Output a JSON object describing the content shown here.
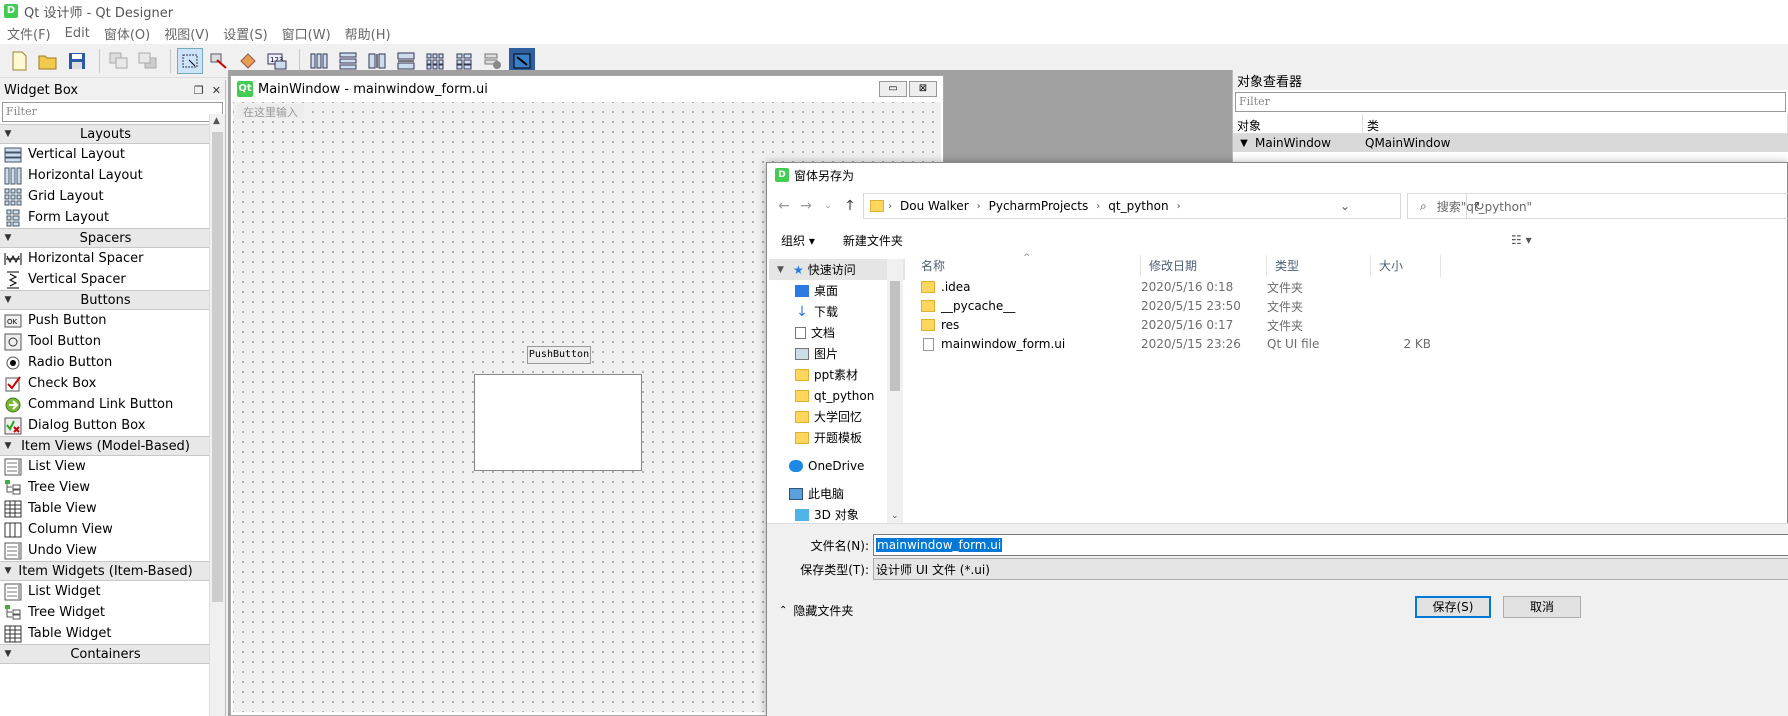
{
  "app": {
    "title": "Qt 设计师 - Qt Designer",
    "icon_letter": "D"
  },
  "menu": [
    "文件(F)",
    "Edit",
    "窗体(O)",
    "视图(V)",
    "设置(S)",
    "窗口(W)",
    "帮助(H)"
  ],
  "widget_box": {
    "title": "Widget Box",
    "filter_placeholder": "Filter",
    "categories": [
      {
        "name": "Layouts",
        "items": [
          "Vertical Layout",
          "Horizontal Layout",
          "Grid Layout",
          "Form Layout"
        ]
      },
      {
        "name": "Spacers",
        "items": [
          "Horizontal Spacer",
          "Vertical Spacer"
        ]
      },
      {
        "name": "Buttons",
        "items": [
          "Push Button",
          "Tool Button",
          "Radio Button",
          "Check Box",
          "Command Link Button",
          "Dialog Button Box"
        ]
      },
      {
        "name": "Item Views (Model-Based)",
        "items": [
          "List View",
          "Tree View",
          "Table View",
          "Column View",
          "Undo View"
        ]
      },
      {
        "name": "Item Widgets (Item-Based)",
        "items": [
          "List Widget",
          "Tree Widget",
          "Table Widget"
        ]
      },
      {
        "name": "Containers",
        "items": []
      }
    ]
  },
  "form_window": {
    "icon_text": "Qt",
    "title": "MainWindow - mainwindow_form.ui",
    "type_here": "在这里输入",
    "push_button": "PushButton"
  },
  "object_inspector": {
    "title": "对象查看器",
    "filter_placeholder": "Filter",
    "col_object": "对象",
    "col_class": "类",
    "row_object": "MainWindow",
    "row_class": "QMainWindow"
  },
  "dialog": {
    "title": "窗体另存为",
    "breadcrumb": [
      "Dou Walker",
      "PycharmProjects",
      "qt_python"
    ],
    "search_placeholder": "搜索\"qt_python\"",
    "organize": "组织 ▾",
    "new_folder": "新建文件夹",
    "nav": [
      {
        "label": "快速访问",
        "icon": "star-icon",
        "pin": false
      },
      {
        "label": "桌面",
        "icon": "desktop-icon",
        "pin": true
      },
      {
        "label": "下载",
        "icon": "download-icon",
        "pin": true
      },
      {
        "label": "文档",
        "icon": "document-icon",
        "pin": true
      },
      {
        "label": "图片",
        "icon": "picture-icon",
        "pin": true
      },
      {
        "label": "ppt素材",
        "icon": "folder-icon",
        "pin": false
      },
      {
        "label": "qt_python",
        "icon": "folder-icon",
        "pin": false
      },
      {
        "label": "大学回忆",
        "icon": "folder-icon",
        "pin": false
      },
      {
        "label": "开题模板",
        "icon": "folder-icon",
        "pin": false
      },
      {
        "label": "OneDrive",
        "icon": "cloud-icon",
        "pin": false
      },
      {
        "label": "此电脑",
        "icon": "computer-icon",
        "pin": false
      },
      {
        "label": "3D 对象",
        "icon": "cube-icon",
        "pin": false
      }
    ],
    "columns": [
      "名称",
      "修改日期",
      "类型",
      "大小"
    ],
    "files": [
      {
        "name": ".idea",
        "date": "2020/5/16 0:18",
        "type": "文件夹",
        "size": "",
        "kind": "folder"
      },
      {
        "name": "__pycache__",
        "date": "2020/5/15 23:50",
        "type": "文件夹",
        "size": "",
        "kind": "folder"
      },
      {
        "name": "res",
        "date": "2020/5/16 0:17",
        "type": "文件夹",
        "size": "",
        "kind": "folder"
      },
      {
        "name": "mainwindow_form.ui",
        "date": "2020/5/15 23:26",
        "type": "Qt UI file",
        "size": "2 KB",
        "kind": "file"
      }
    ],
    "filename_label": "文件名(N):",
    "filename_value": "mainwindow_form.ui",
    "savetype_label": "保存类型(T):",
    "savetype_value": "设计师 UI 文件 (*.ui)",
    "hide_folders": "隐藏文件夹",
    "save": "保存(S)",
    "cancel": "取消"
  }
}
